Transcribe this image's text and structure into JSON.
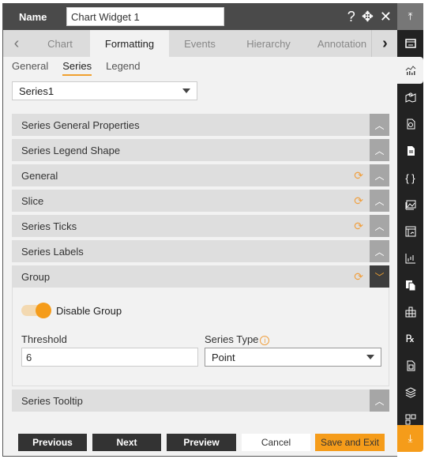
{
  "header": {
    "name_label": "Name",
    "name_value": "Chart Widget 1",
    "help_icon": "?",
    "move_icon": "✥",
    "close_icon": "✕"
  },
  "tabs": {
    "prev_arrow": "‹",
    "next_arrow": "›",
    "items": [
      "Chart",
      "Formatting",
      "Events",
      "Hierarchy",
      "Annotation"
    ],
    "active": "Formatting"
  },
  "subtabs": {
    "items": [
      "General",
      "Series",
      "Legend"
    ],
    "active": "Series"
  },
  "series_select": {
    "value": "Series1"
  },
  "sections": [
    {
      "title": "Series General Properties",
      "refresh": false,
      "expanded": false
    },
    {
      "title": "Series Legend Shape",
      "refresh": false,
      "expanded": false
    },
    {
      "title": "General",
      "refresh": true,
      "expanded": false
    },
    {
      "title": "Slice",
      "refresh": true,
      "expanded": false
    },
    {
      "title": "Series Ticks",
      "refresh": true,
      "expanded": false
    },
    {
      "title": "Series Labels",
      "refresh": false,
      "expanded": false
    },
    {
      "title": "Group",
      "refresh": true,
      "expanded": true
    },
    {
      "title": "Series Tooltip",
      "refresh": false,
      "expanded": false
    }
  ],
  "group": {
    "disable_group_label": "Disable Group",
    "disable_group_on": true,
    "threshold_label": "Threshold",
    "threshold_value": "6",
    "series_type_label": "Series Type",
    "series_type_value": "Point"
  },
  "footer": {
    "previous": "Previous",
    "next": "Next",
    "preview": "Preview",
    "cancel": "Cancel",
    "save_exit": "Save and Exit"
  },
  "sidebar": {
    "items": [
      "scroll-top",
      "widget-settings",
      "chart",
      "map",
      "report",
      "document",
      "script",
      "image",
      "calendar",
      "stock-chart",
      "copy",
      "hierarchy",
      "rx",
      "sheet",
      "layers",
      "dashboard",
      "scroll-bottom"
    ],
    "active": "chart"
  },
  "colors": {
    "accent": "#f59c1a",
    "header_bg": "#4a4a4a",
    "sidebar_bg": "#222222",
    "section_bg": "#dedede"
  }
}
